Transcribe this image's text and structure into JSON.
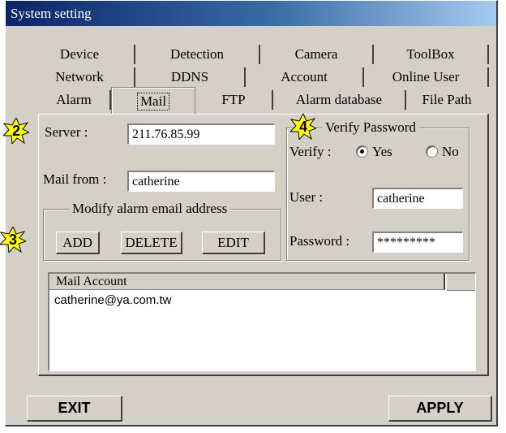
{
  "window": {
    "title": "System setting"
  },
  "tabs": {
    "row1": [
      "Device",
      "Detection",
      "Camera",
      "ToolBox"
    ],
    "row2": [
      "Network",
      "DDNS",
      "Account",
      "Online User"
    ],
    "row3": [
      "Alarm",
      "Mail",
      "FTP",
      "Alarm database",
      "File Path"
    ],
    "selected": "Mail"
  },
  "server": {
    "label": "Server :",
    "value": "211.76.85.99"
  },
  "mail_from": {
    "label": "Mail from :",
    "value": "catherine"
  },
  "modify_group": {
    "title": "Modify alarm email address",
    "add": "ADD",
    "delete": "DELETE",
    "edit": "EDIT"
  },
  "verify_group": {
    "title": "Verify Password",
    "verify_label": "Verify :",
    "yes": "Yes",
    "no": "No",
    "selected": "Yes",
    "user_label": "User :",
    "user_value": "catherine",
    "password_label": "Password :",
    "password_value": "*********"
  },
  "mail_list": {
    "header": "Mail Account",
    "rows": [
      "catherine@ya.com.tw"
    ]
  },
  "buttons": {
    "exit": "EXIT",
    "apply": "APPLY"
  },
  "badges": [
    "2",
    "3",
    "4"
  ],
  "colors": {
    "badge_fill": "#ffff00",
    "titlebar": "#0a246a",
    "face": "#d4d0c8"
  }
}
